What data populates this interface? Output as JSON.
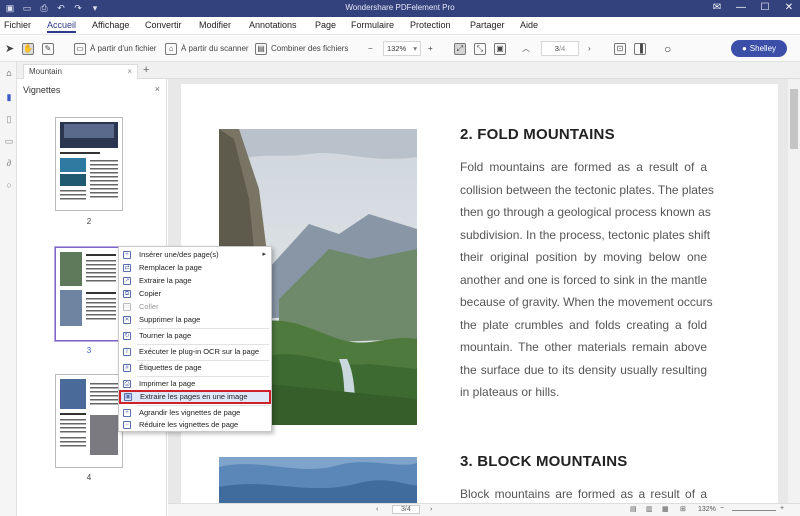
{
  "app": {
    "title": "Wondershare PDFelement Pro"
  },
  "quick_access": [
    "save-icon",
    "print-icon",
    "undo-icon",
    "redo-icon",
    "dropdown-icon"
  ],
  "menu": {
    "items": [
      "Fichier",
      "Accueil",
      "Affichage",
      "Convertir",
      "Modifier",
      "Annotations",
      "Page",
      "Formulaire",
      "Protection",
      "Partager",
      "Aide"
    ],
    "active": "Accueil"
  },
  "toolbar": {
    "from_file": "À partir d'un fichier",
    "from_scanner": "À partir du scanner",
    "combine": "Combiner des fichiers",
    "zoom_minus": "−",
    "zoom_plus": "+",
    "zoom_value": "132%",
    "page_current": "3",
    "page_total": "/4",
    "user": "Shelley"
  },
  "tab": {
    "name": "Mountain",
    "close": "×",
    "add": "+"
  },
  "panel": {
    "title": "Vignettes",
    "close": "×",
    "pages": [
      "2",
      "3",
      "4"
    ],
    "selected_page": "3"
  },
  "context_menu": {
    "items": [
      {
        "label": "Insérer une/des page(s)",
        "icon": "insert-page-icon",
        "submenu": true
      },
      {
        "label": "Remplacer la page",
        "icon": "replace-page-icon"
      },
      {
        "label": "Extraire la page",
        "icon": "extract-page-icon"
      },
      {
        "label": "Copier",
        "icon": "copy-icon"
      },
      {
        "label": "Coller",
        "icon": "paste-icon",
        "disabled": true
      },
      {
        "label": "Supprimer la page",
        "icon": "delete-icon"
      },
      {
        "label": "Tourner la page",
        "icon": "rotate-icon"
      },
      {
        "label": "Exécuter le plug-in OCR sur la page",
        "icon": "ocr-icon"
      },
      {
        "label": "Étiquettes de page",
        "icon": "labels-icon"
      },
      {
        "label": "Imprimer la page",
        "icon": "print-icon"
      },
      {
        "label": "Extraire les pages en une image",
        "icon": "image-icon",
        "highlighted": true
      },
      {
        "label": "Agrandir les vignettes de page",
        "icon": "zoom-in-icon"
      },
      {
        "label": "Réduire les vignettes de page",
        "icon": "zoom-out-icon"
      }
    ]
  },
  "document": {
    "heading1": "2. FOLD MOUNTAINS",
    "para1": [
      "Fold mountains are formed as a result of a",
      "collision between the tectonic plates. The plates",
      "then go through a geological process known as",
      "subdivision. In the process, tectonic plates shift",
      "their original position by moving below one",
      "another and one is forced to sink in the mantle",
      "because of gravity. When the movement occurs",
      "the plate crumbles and folds creating a fold",
      "mountain. The other materials remain above",
      "the surface due to its density usually resulting",
      "in plateaus or hills."
    ],
    "heading2": "3. BLOCK MOUNTAINS",
    "para2_first": "Block mountains are formed as a result of a"
  },
  "statusbar": {
    "page": "3/4",
    "zoom": "132%"
  }
}
